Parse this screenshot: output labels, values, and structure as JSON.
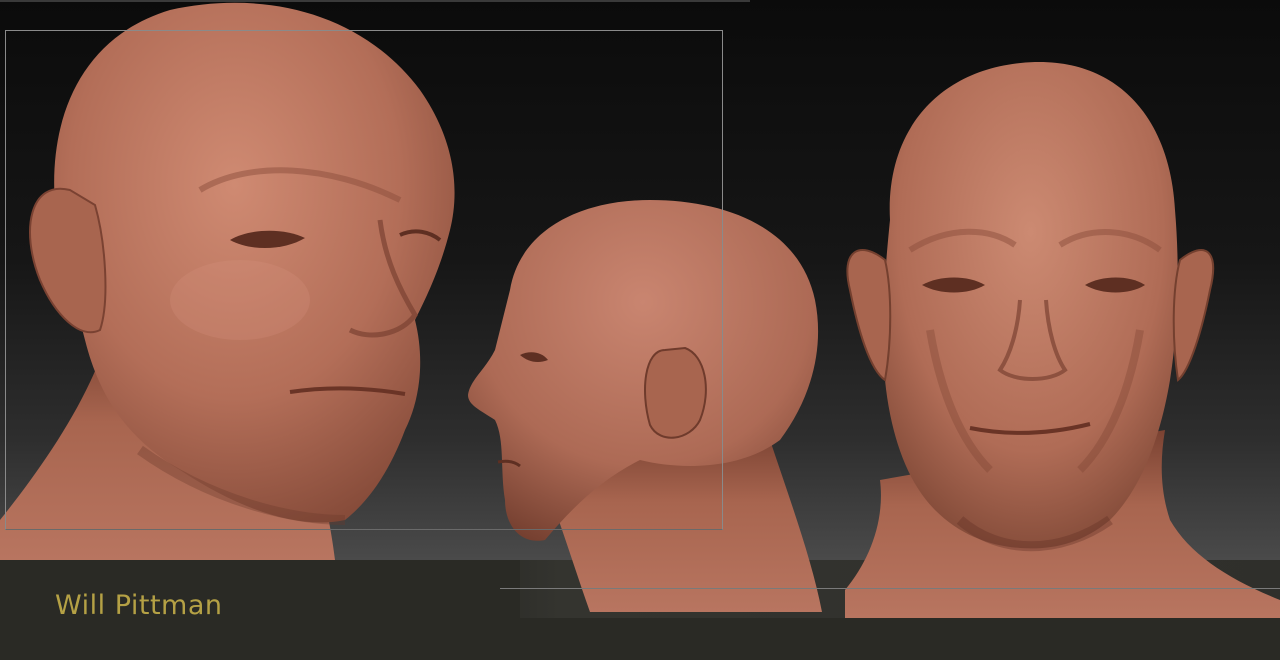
{
  "artist": {
    "name": "Will Pittman"
  },
  "palette": {
    "skin": "#b5705a",
    "skin_shadow": "#7a4232",
    "skin_highlight": "#cf8a72",
    "name_text": "#b5a145",
    "footer_band": "#2a2a25"
  },
  "views": [
    {
      "name": "three-quarter-view"
    },
    {
      "name": "profile-view"
    },
    {
      "name": "front-view"
    }
  ]
}
